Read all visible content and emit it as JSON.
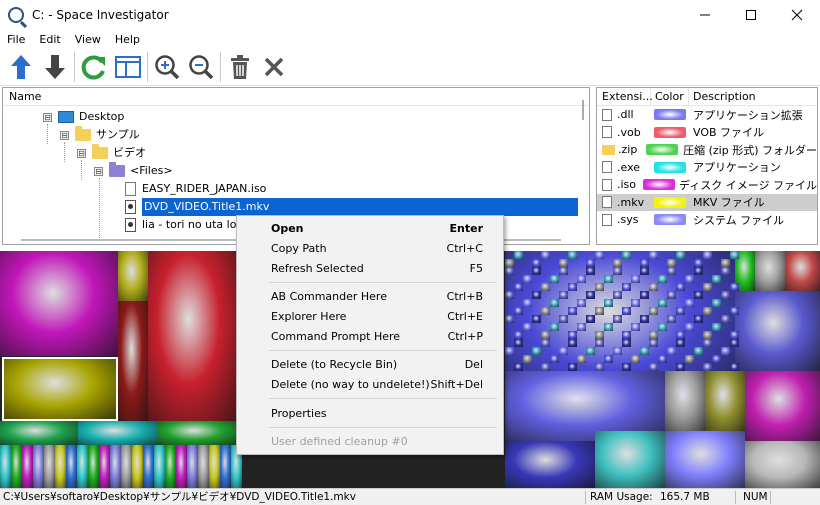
{
  "window": {
    "title": "C: - Space Investigator"
  },
  "menu": [
    "File",
    "Edit",
    "View",
    "Help"
  ],
  "toolbar": {
    "icons": [
      "arrow-up-icon",
      "arrow-down-icon",
      "refresh-icon",
      "layout-icon",
      "zoom-in-icon",
      "zoom-out-icon",
      "delete-icon",
      "close-icon"
    ],
    "colors": {
      "blue": "#2a6fc9",
      "green": "#2e9b3e",
      "gray": "#555555"
    }
  },
  "tree": {
    "header": "Name",
    "rows": [
      {
        "label": "Desktop",
        "type": "desktop",
        "expander": "⊟"
      },
      {
        "label": "サンプル",
        "type": "folder",
        "expander": "⊟"
      },
      {
        "label": "ビデオ",
        "type": "folder",
        "expander": "⊟"
      },
      {
        "label": "<Files>",
        "type": "files",
        "expander": "⊟"
      },
      {
        "label": "EASY_RIDER_JAPAN.iso",
        "type": "file"
      },
      {
        "label": "DVD_VIDEO.Title1.mkv",
        "type": "mkv",
        "selected": true
      },
      {
        "label": "lia - tori no uta lond",
        "type": "mkv"
      }
    ]
  },
  "extensions": {
    "headers": {
      "ext": "Extensi...",
      "color": "Color",
      "desc": "Description"
    },
    "rows": [
      {
        "ext": ".dll",
        "color": "#7a7af0",
        "desc": "アプリケーション拡張"
      },
      {
        "ext": ".vob",
        "color": "#f05a6a",
        "desc": "VOB ファイル"
      },
      {
        "ext": ".zip",
        "color": "#4fd24f",
        "desc": "圧縮 (zip 形式) フォルダー"
      },
      {
        "ext": ".exe",
        "color": "#22e3e3",
        "desc": "アプリケーション"
      },
      {
        "ext": ".iso",
        "color": "#e02ed6",
        "desc": "ディスク イメージ ファイル"
      },
      {
        "ext": ".mkv",
        "color": "#f2f20a",
        "desc": "MKV ファイル",
        "selected": true
      },
      {
        "ext": ".sys",
        "color": "#8a8af5",
        "desc": "システム ファイル"
      }
    ]
  },
  "context_menu": {
    "items": [
      {
        "label": "Open",
        "shortcut": "Enter",
        "bold": true
      },
      {
        "label": "Copy Path",
        "shortcut": "Ctrl+C"
      },
      {
        "label": "Refresh Selected",
        "shortcut": "F5"
      },
      {
        "label": "AB Commander Here",
        "shortcut": "Ctrl+B"
      },
      {
        "label": "Explorer Here",
        "shortcut": "Ctrl+E"
      },
      {
        "label": "Command Prompt Here",
        "shortcut": "Ctrl+P"
      },
      {
        "label": "Delete (to Recycle Bin)",
        "shortcut": "Del"
      },
      {
        "label": "Delete (no way to undelete!)",
        "shortcut": "Shift+Del"
      },
      {
        "label": "Properties",
        "shortcut": ""
      },
      {
        "label": "User defined cleanup #0",
        "shortcut": "",
        "disabled": true
      }
    ]
  },
  "status": {
    "path": "C:¥Users¥softaro¥Desktop¥サンプル¥ビデオ¥DVD_VIDEO.Title1.mkv",
    "ram_label": "RAM Usage:",
    "ram_value": "165.7 MB",
    "num": "NUM"
  }
}
